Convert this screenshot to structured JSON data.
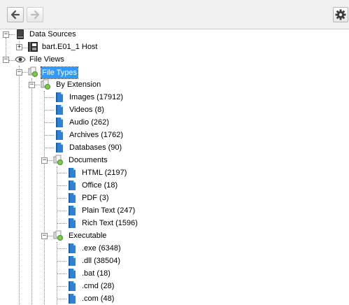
{
  "toolbar": {
    "back_icon": "arrow-left-icon",
    "forward_icon": "arrow-right-icon",
    "settings_icon": "gear-icon"
  },
  "tree": {
    "data_sources": "Data Sources",
    "host": "bart.E01_1 Host",
    "file_views": "File Views",
    "file_types": "File Types",
    "by_extension": "By Extension",
    "images": "Images (17912)",
    "videos": "Videos (8)",
    "audio": "Audio (262)",
    "archives": "Archives (1762)",
    "databases": "Databases (90)",
    "documents": "Documents",
    "html": "HTML (2197)",
    "office": "Office (18)",
    "pdf": "PDF (3)",
    "plain_text": "Plain Text (247)",
    "rich_text": "Rich Text (1596)",
    "executable": "Executable",
    "exe": ".exe (6348)",
    "dll": ".dll (38504)",
    "bat": ".bat (18)",
    "cmd": ".cmd (28)",
    "com": ".com (48)"
  },
  "colors": {
    "selection": "#3399ff",
    "toolbar_bg": "#f0f0f0",
    "file_icon_blue": "#2f82d3"
  }
}
